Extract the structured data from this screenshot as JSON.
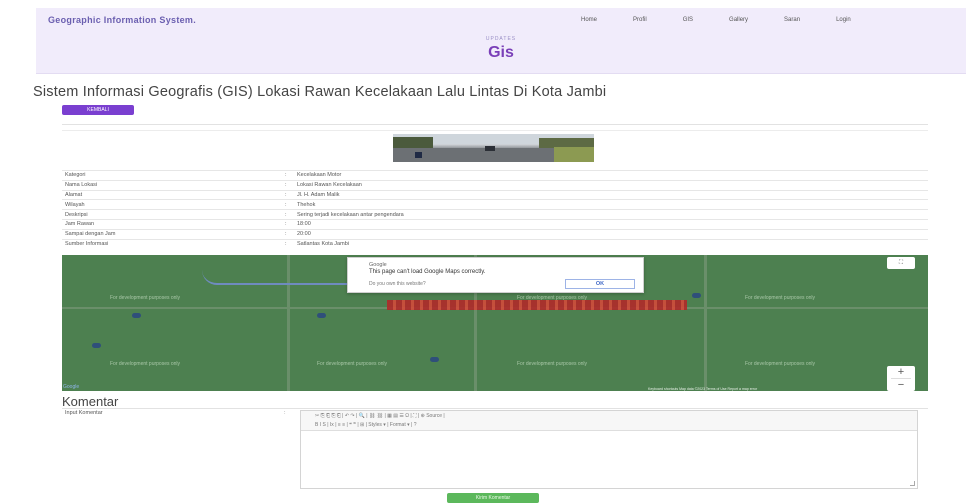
{
  "header": {
    "brand": "Geographic Information System.",
    "nav": [
      "Home",
      "Profil",
      "GIS",
      "Gallery",
      "Saran",
      "Login"
    ],
    "breadcrumb": "UPDATES",
    "heading": "Gis"
  },
  "page": {
    "title": "Sistem Informasi Geografis (GIS) Lokasi Rawan Kecelakaan Lalu Lintas Di Kota Jambi",
    "back_button": "KEMBALI"
  },
  "details": [
    {
      "label": "Kategori",
      "sep": ":",
      "value": "Kecelakaan Motor"
    },
    {
      "label": "Nama Lokasi",
      "sep": ":",
      "value": "Lokasi Rawan Kecelakaan"
    },
    {
      "label": "Alamat",
      "sep": ":",
      "value": "Jl. H. Adam Malik"
    },
    {
      "label": "Wilayah",
      "sep": ":",
      "value": "Thehok"
    },
    {
      "label": "Deskripsi",
      "sep": ":",
      "value": "Sering terjadi kecelakaan antar pengendara"
    },
    {
      "label": "Jam Rawan",
      "sep": ":",
      "value": "18:00"
    },
    {
      "label": "Sampai dengan Jam",
      "sep": ":",
      "value": "20:00"
    },
    {
      "label": "Sumber Informasi",
      "sep": ":",
      "value": "Satlantas Kota Jambi"
    }
  ],
  "map": {
    "dialog_title": "Google",
    "dialog_message": "This page can't load Google Maps correctly.",
    "dialog_question": "Do you own this website?",
    "dialog_ok": "OK",
    "watermark": "For development purposes only",
    "fullscreen": "⛶",
    "zoom_in": "+",
    "zoom_out": "−",
    "logo": "Google",
    "footer": "Keyboard shortcuts   Map data ©2023   Terms of Use   Report a map error"
  },
  "komentar": {
    "heading": "Komentar",
    "input_label": "Input Komentar",
    "colon": ":",
    "toolbar_row1": "✂  ⎘  ⎗  ⎘  ⎗  |  ↶  ↷  |  🔍  |  ⛓  ⛓  |  ▦  ▤  ☰  Ω  |  ⛶  |  ⊕ Source  |",
    "toolbar_row2": "B  I  S  |  Ix  |  ≡  ≡  |  ❝  ❞  |  ⊞  |  Styles    ▾  |  Format    ▾  |  ?",
    "submit": "Kirim Komentar"
  }
}
